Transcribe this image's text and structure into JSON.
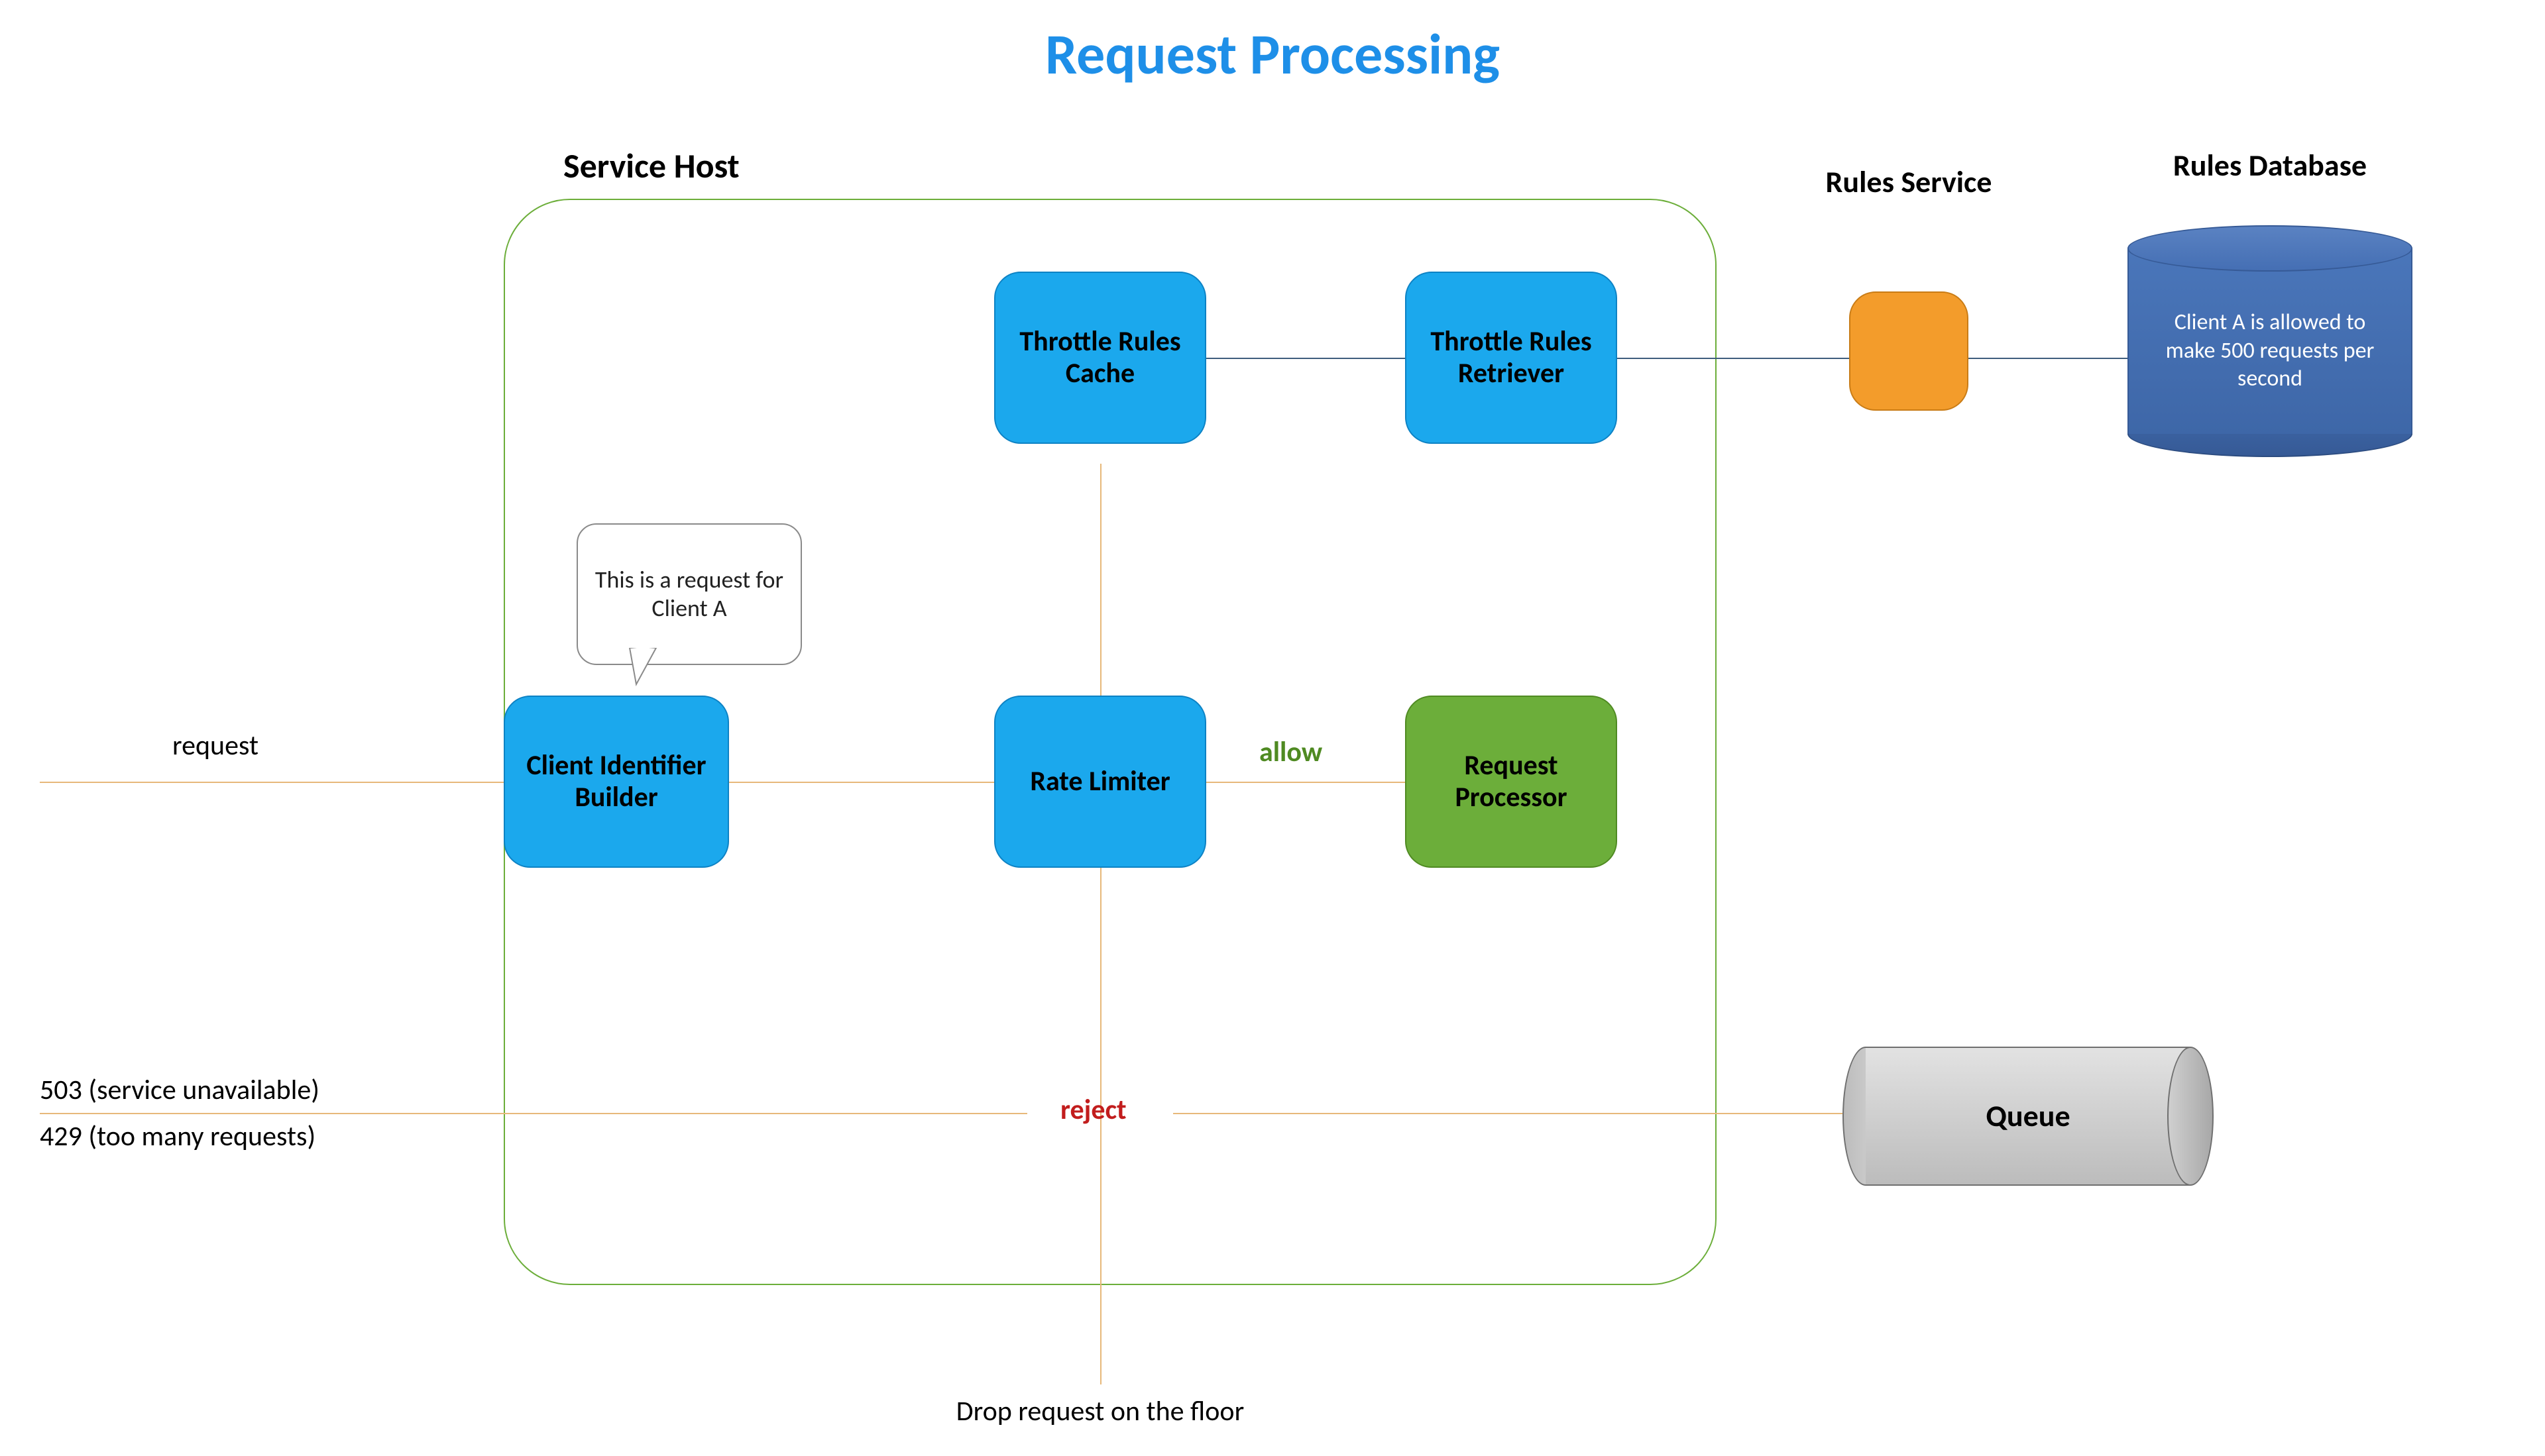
{
  "title": "Request Processing",
  "service_host_label": "Service Host",
  "rules_service_label": "Rules Service",
  "rules_database_label": "Rules Database",
  "nodes": {
    "client_identifier_builder": "Client Identifier Builder",
    "throttle_rules_cache": "Throttle Rules Cache",
    "throttle_rules_retriever": "Throttle Rules Retriever",
    "rate_limiter": "Rate Limiter",
    "request_processor": "Request Processor"
  },
  "callout_text": "This is a request for Client A",
  "edges": {
    "request": "request",
    "allow": "allow",
    "reject": "reject"
  },
  "responses": {
    "line1": "503 (service unavailable)",
    "line2": "429 (too many requests)"
  },
  "drop_text": "Drop request on the floor",
  "queue_label": "Queue",
  "db_rule_text": "Client A is allowed to make 500 requests per second"
}
